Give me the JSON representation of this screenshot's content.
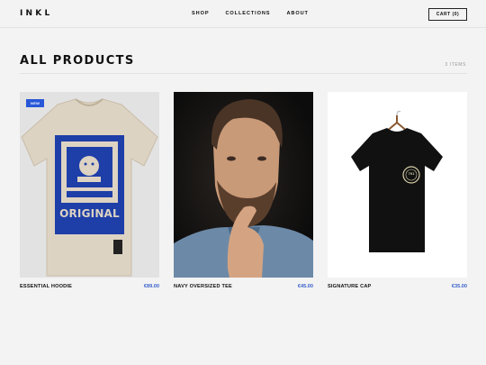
{
  "header": {
    "logo": "INKL",
    "nav": [
      "SHOP",
      "COLLECTIONS",
      "ABOUT"
    ],
    "cart": "CART (0)"
  },
  "main": {
    "title": "ALL PRODUCTS",
    "count": "3 ITEMS",
    "products": [
      {
        "name": "ESSENTIAL HOODIE",
        "price": "€89.00",
        "badge": "NEW",
        "graphic_text": "ORIGINAL"
      },
      {
        "name": "NAVY OVERSIZED TEE",
        "price": "€45.00"
      },
      {
        "name": "SIGNATURE CAP",
        "price": "€35.00",
        "graphic_text": "701"
      }
    ]
  },
  "colors": {
    "accent": "#2957d8",
    "price": "#3a62cc",
    "background": "#f3f3f3"
  }
}
